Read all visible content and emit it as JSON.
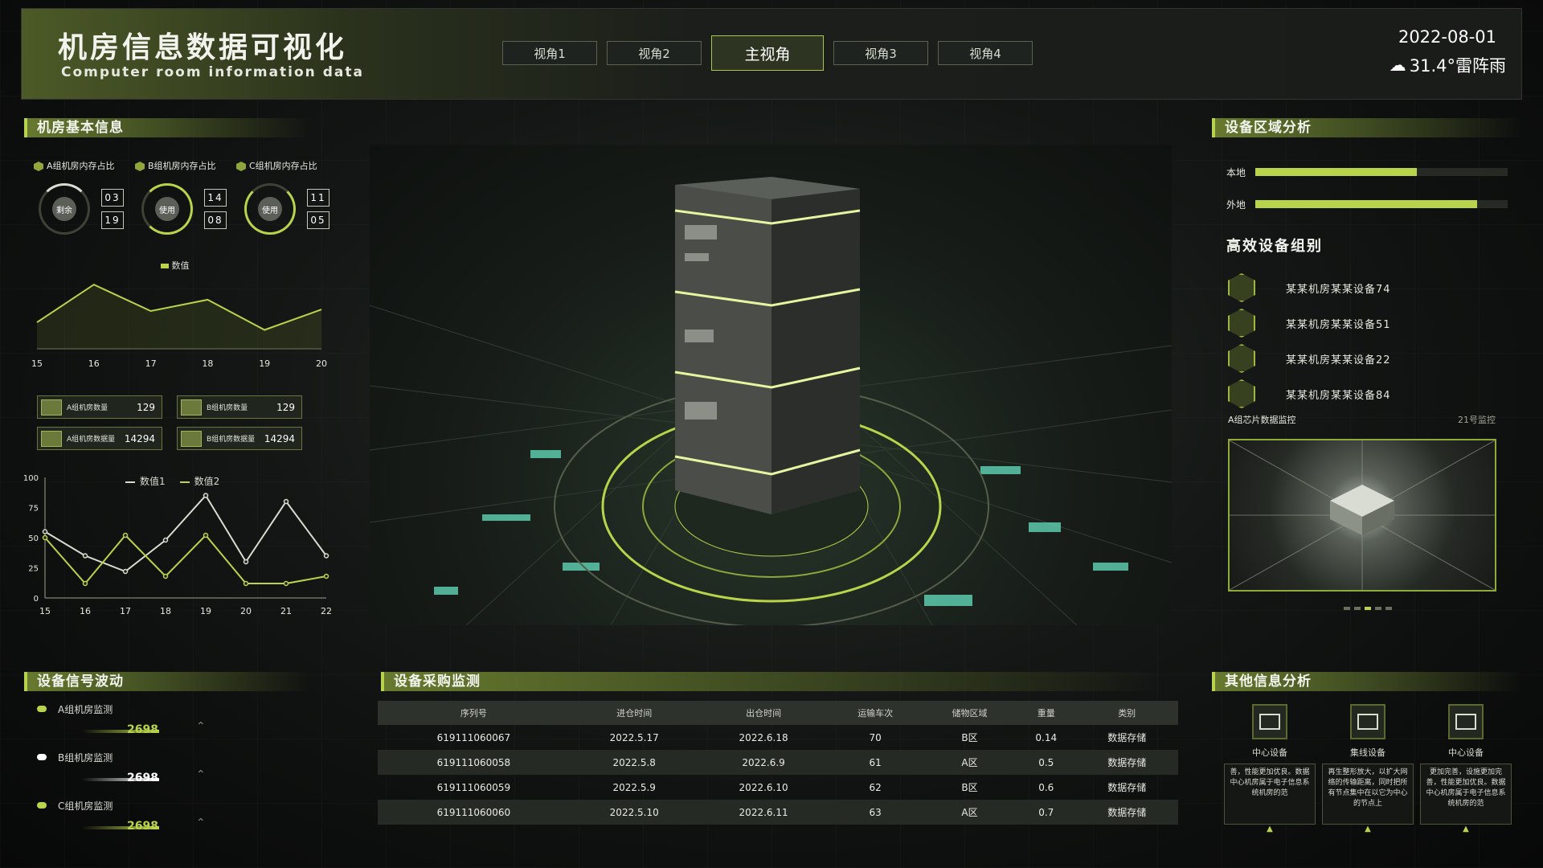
{
  "header": {
    "title": "机房信息数据可视化",
    "subtitle": "Computer room information data",
    "tabs": [
      "视角1",
      "视角2",
      "主视角",
      "视角3",
      "视角4"
    ],
    "active_tab": "主视角",
    "date": "2022-08-01",
    "weather": "31.4°雷阵雨"
  },
  "left": {
    "basic_info_title": "机房基本信息",
    "gauges": [
      {
        "label": "A组机房内存占比",
        "center": "剩余",
        "top": "03",
        "bottom": "19",
        "fill": 0.15
      },
      {
        "label": "B组机房内存占比",
        "center": "使用",
        "top": "14",
        "bottom": "08",
        "fill": 0.65
      },
      {
        "label": "C组机房内存占比",
        "center": "使用",
        "top": "11",
        "bottom": "05",
        "fill": 0.7
      }
    ],
    "stats": [
      {
        "label": "A组机房数量",
        "value": "129"
      },
      {
        "label": "B组机房数量",
        "value": "129"
      },
      {
        "label": "A组机房数据量",
        "value": "14294"
      },
      {
        "label": "B组机房数据量",
        "value": "14294"
      }
    ],
    "signal_title": "设备信号波动",
    "signals": [
      {
        "label": "A组机房监测",
        "value": "2698",
        "color": "#b8d44a"
      },
      {
        "label": "B组机房监测",
        "value": "2698",
        "color": "#ffffff"
      },
      {
        "label": "C组机房监测",
        "value": "2698",
        "color": "#b8d44a"
      }
    ]
  },
  "chart_data": [
    {
      "type": "area",
      "legend": [
        "数值"
      ],
      "categories": [
        "15",
        "16",
        "17",
        "18",
        "19",
        "20"
      ],
      "series": [
        {
          "name": "数值",
          "values": [
            35,
            85,
            50,
            65,
            25,
            52
          ]
        }
      ],
      "ylim": [
        0,
        100
      ]
    },
    {
      "type": "line",
      "categories": [
        "15",
        "16",
        "17",
        "18",
        "19",
        "20",
        "21",
        "22"
      ],
      "ylim": [
        0,
        100
      ],
      "yticks": [
        "0",
        "25",
        "50",
        "75",
        "100"
      ],
      "series": [
        {
          "name": "数值1",
          "values": [
            55,
            35,
            22,
            48,
            85,
            30,
            80,
            35
          ],
          "color": "#d8dccf"
        },
        {
          "name": "数值2",
          "values": [
            50,
            12,
            52,
            18,
            52,
            12,
            12,
            18
          ],
          "color": "#b8d44a"
        }
      ]
    }
  ],
  "right": {
    "area_title": "设备区域分析",
    "bars": [
      {
        "label": "本地",
        "value": 0.64
      },
      {
        "label": "外地",
        "value": 0.88
      }
    ],
    "group_title": "高效设备组别",
    "devices": [
      "某某机房某某设备74",
      "某某机房某某设备51",
      "某某机房某某设备22",
      "某某机房某某设备84"
    ],
    "monitor_label": "A组芯片数据监控",
    "monitor_tag": "21号监控",
    "other_title": "其他信息分析",
    "other_items": [
      {
        "label": "中心设备",
        "text": "善，性能更加优良。数据中心机房属于电子信息系统机房的范"
      },
      {
        "label": "集线设备",
        "text": "再生整形放大，以扩大网络的传输距离，同时把所有节点集中在以它为中心的节点上"
      },
      {
        "label": "中心设备",
        "text": "更加完善，设施更加完善，性能更加优良。数据中心机房属于电子信息系统机房的范"
      }
    ]
  },
  "table": {
    "title": "设备采购监测",
    "columns": [
      "序列号",
      "进仓时间",
      "出仓时间",
      "运输车次",
      "储物区域",
      "重量",
      "类别"
    ],
    "rows": [
      [
        "619111060067",
        "2022.5.17",
        "2022.6.18",
        "70",
        "B区",
        "0.14",
        "数据存储"
      ],
      [
        "619111060058",
        "2022.5.8",
        "2022.6.9",
        "61",
        "A区",
        "0.5",
        "数据存储"
      ],
      [
        "619111060059",
        "2022.5.9",
        "2022.6.10",
        "62",
        "B区",
        "0.6",
        "数据存储"
      ],
      [
        "619111060060",
        "2022.5.10",
        "2022.6.11",
        "63",
        "A区",
        "0.7",
        "数据存储"
      ]
    ]
  }
}
